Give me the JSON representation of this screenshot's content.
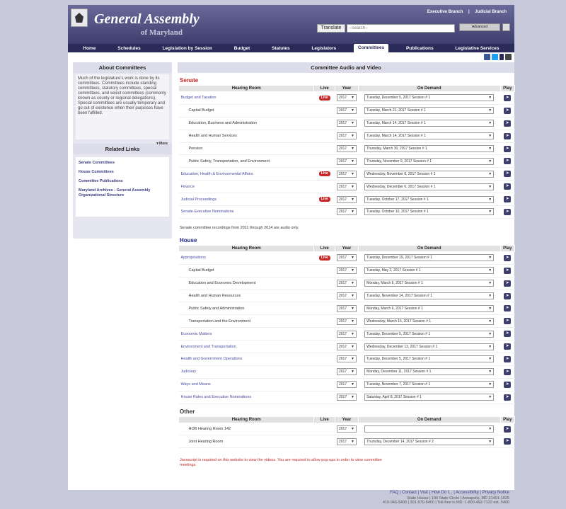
{
  "header": {
    "title": "General Assembly",
    "subtitle": "of Maryland",
    "top_links": [
      "Executive Branch",
      "|",
      "Judicial Branch"
    ],
    "translate_label": "Translate",
    "search_placeholder": "--Search--",
    "advanced_label": "Advanced"
  },
  "nav": [
    "Home",
    "Schedules",
    "Legislation by Session",
    "Budget",
    "Statutes",
    "Legislators",
    "Committees",
    "Publications",
    "Legislative Services"
  ],
  "sidebar": {
    "about_title": "About Committees",
    "about_text": "Much of the legislature's work is done by its committees. Committees include standing committees, statutory committees, special committees, and select committees (commonly known as county or regional delegations). Special committees are usually temporary and go out of existence when their purposes have been fulfilled.",
    "more_label": "▼More",
    "related_title": "Related Links",
    "related_links": [
      "Senate Committees",
      "House Committees",
      "Committee Publications",
      "Maryland Archives - General Assembly Organizational Structure"
    ]
  },
  "main": {
    "title": "Committee Audio and Video",
    "headers": [
      "Hearing Room",
      "Live",
      "Year",
      "On Demand",
      "Play"
    ],
    "live_label": "Live",
    "senate_title": "Senate",
    "senate_rows": [
      {
        "room": "Budget and Taxation",
        "sub": false,
        "live": true,
        "year": "2017",
        "od": "Tuesday, December 5, 2017 Session # 1"
      },
      {
        "room": "Capital Budget",
        "sub": true,
        "live": false,
        "year": "2017",
        "od": "Tuesday, March 21, 2017 Session # 1"
      },
      {
        "room": "Education, Business and Administration",
        "sub": true,
        "live": false,
        "year": "2017",
        "od": "Tuesday, March 14, 2017 Session # 1"
      },
      {
        "room": "Health and Human Services",
        "sub": true,
        "live": false,
        "year": "2017",
        "od": "Tuesday, March 14, 2017 Session # 1"
      },
      {
        "room": "Pension",
        "sub": true,
        "live": false,
        "year": "2017",
        "od": "Thursday, March 30, 2017 Session # 1"
      },
      {
        "room": "Public Safety, Transportation, and Environment",
        "sub": true,
        "live": false,
        "year": "2017",
        "od": "Thursday, November 9, 2017 Session # 1"
      },
      {
        "room": "Education, Health & Environmental Affairs",
        "sub": false,
        "live": true,
        "year": "2017",
        "od": "Wednesday, November 8, 2017 Session # 1"
      },
      {
        "room": "Finance",
        "sub": false,
        "live": false,
        "year": "2017",
        "od": "Wednesday, December 6, 2017 Session # 1"
      },
      {
        "room": "Judicial Proceedings",
        "sub": false,
        "live": true,
        "year": "2017",
        "od": "Tuesday, October 17, 2017 Session # 1"
      },
      {
        "room": "Senate Executive Nominations",
        "sub": false,
        "live": false,
        "year": "2017",
        "od": "Tuesday, October 10, 2017 Session # 1"
      }
    ],
    "senate_note": "Senate committee recordings from 2011 through 2014 are audio only.",
    "house_title": "House",
    "house_rows": [
      {
        "room": "Appropriations",
        "sub": false,
        "live": true,
        "year": "2017",
        "od": "Tuesday, December 19, 2017 Session # 1"
      },
      {
        "room": "Capital Budget",
        "sub": true,
        "live": false,
        "year": "2017",
        "od": "Tuesday, May 2, 2017 Session # 1"
      },
      {
        "room": "Education and Economic Development",
        "sub": true,
        "live": false,
        "year": "2017",
        "od": "Monday, March 6, 2017 Session # 1"
      },
      {
        "room": "Health and Human Resources",
        "sub": true,
        "live": false,
        "year": "2017",
        "od": "Tuesday, November 14, 2017 Session # 1"
      },
      {
        "room": "Public Safety and Administration",
        "sub": true,
        "live": false,
        "year": "2017",
        "od": "Monday, March 6, 2017 Session # 1"
      },
      {
        "room": "Transportation and the Environment",
        "sub": true,
        "live": false,
        "year": "2017",
        "od": "Wednesday, March 15, 2017 Session # 1"
      },
      {
        "room": "Economic Matters",
        "sub": false,
        "live": false,
        "year": "2017",
        "od": "Tuesday, December 5, 2017 Session # 1"
      },
      {
        "room": "Environment and Transportation",
        "sub": false,
        "live": false,
        "year": "2017",
        "od": "Wednesday, December 13, 2017 Session # 1"
      },
      {
        "room": "Health and Government Operations",
        "sub": false,
        "live": false,
        "year": "2017",
        "od": "Tuesday, December 5, 2017 Session # 1"
      },
      {
        "room": "Judiciary",
        "sub": false,
        "live": false,
        "year": "2017",
        "od": "Monday, December 11, 2017 Session # 1"
      },
      {
        "room": "Ways and Means",
        "sub": false,
        "live": false,
        "year": "2017",
        "od": "Tuesday, November 7, 2017 Session # 1"
      },
      {
        "room": "House Rules and Executive Nominations",
        "sub": false,
        "live": false,
        "year": "2017",
        "od": "Saturday, April 8, 2017 Session # 1"
      }
    ],
    "other_title": "Other",
    "other_rows": [
      {
        "room": "HOB Hearing Room 142",
        "sub": true,
        "live": false,
        "year": "2017",
        "od": ""
      },
      {
        "room": "Joint Hearing Room",
        "sub": true,
        "live": false,
        "year": "2017",
        "od": "Thursday, December 14, 2017 Session # 2"
      }
    ],
    "warning": "Javascript is required on this website to view the videos. You are required to allow pop-ups in order to view committee meetings."
  },
  "footer": {
    "links": "FAQ  |  Contact  |  Visit  |  How Do I...  |  Accessibility  |  Privacy Notice",
    "address": "State House  |  100 State Circle  |  Annapolis, MD 21401-1925",
    "phones": "410-946-5400  |  301-970-5400  |  Toll-free in MD: 1-800-492-7122 ext. 5400"
  }
}
